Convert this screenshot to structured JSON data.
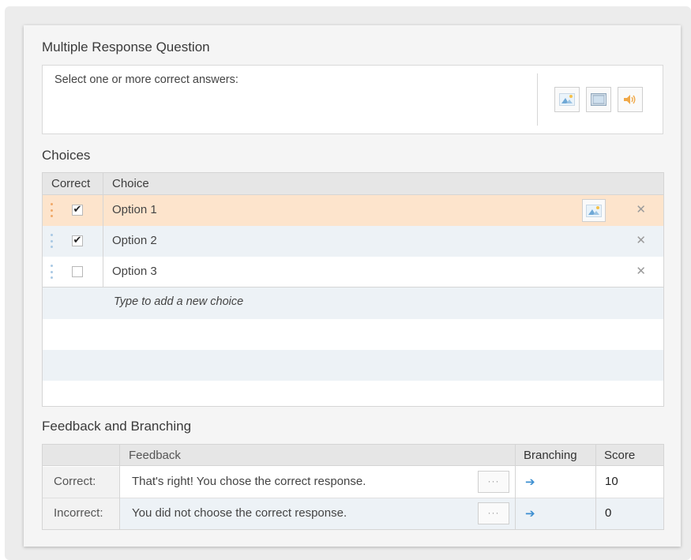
{
  "question": {
    "section_title": "Multiple Response Question",
    "prompt_text": "Select one or more correct answers:"
  },
  "choices": {
    "section_title": "Choices",
    "headers": {
      "correct": "Correct",
      "choice": "Choice"
    },
    "items": [
      {
        "label": "Option 1",
        "checked": true,
        "selected": true,
        "checkmark": "✔",
        "delete": "✕"
      },
      {
        "label": "Option 2",
        "checked": true,
        "selected": false,
        "checkmark": "✔",
        "delete": "✕"
      },
      {
        "label": "Option 3",
        "checked": false,
        "selected": false,
        "checkmark": "",
        "delete": "✕"
      }
    ],
    "add_placeholder": "Type to add a new choice"
  },
  "feedback": {
    "section_title": "Feedback and Branching",
    "headers": {
      "feedback": "Feedback",
      "branching": "Branching",
      "score": "Score"
    },
    "rows": [
      {
        "label": "Correct:",
        "text": "That's right!  You chose the correct response.",
        "more": "···",
        "branch_icon": "➔",
        "score": "10"
      },
      {
        "label": "Incorrect:",
        "text": "You did not choose the correct response.",
        "more": "···",
        "branch_icon": "➔",
        "score": "0"
      }
    ]
  },
  "icons": [
    "image-icon",
    "video-icon",
    "audio-icon",
    "drag-handle-icon",
    "checkbox-icon",
    "delete-icon",
    "more-icon",
    "branch-arrow-icon"
  ],
  "colors": {
    "selected_row": "#fde4cc",
    "alt_row": "#edf2f6",
    "accent_blue": "#3d8fd1",
    "drag_orange": "#f0a868",
    "drag_blue": "#a9c9e4"
  }
}
